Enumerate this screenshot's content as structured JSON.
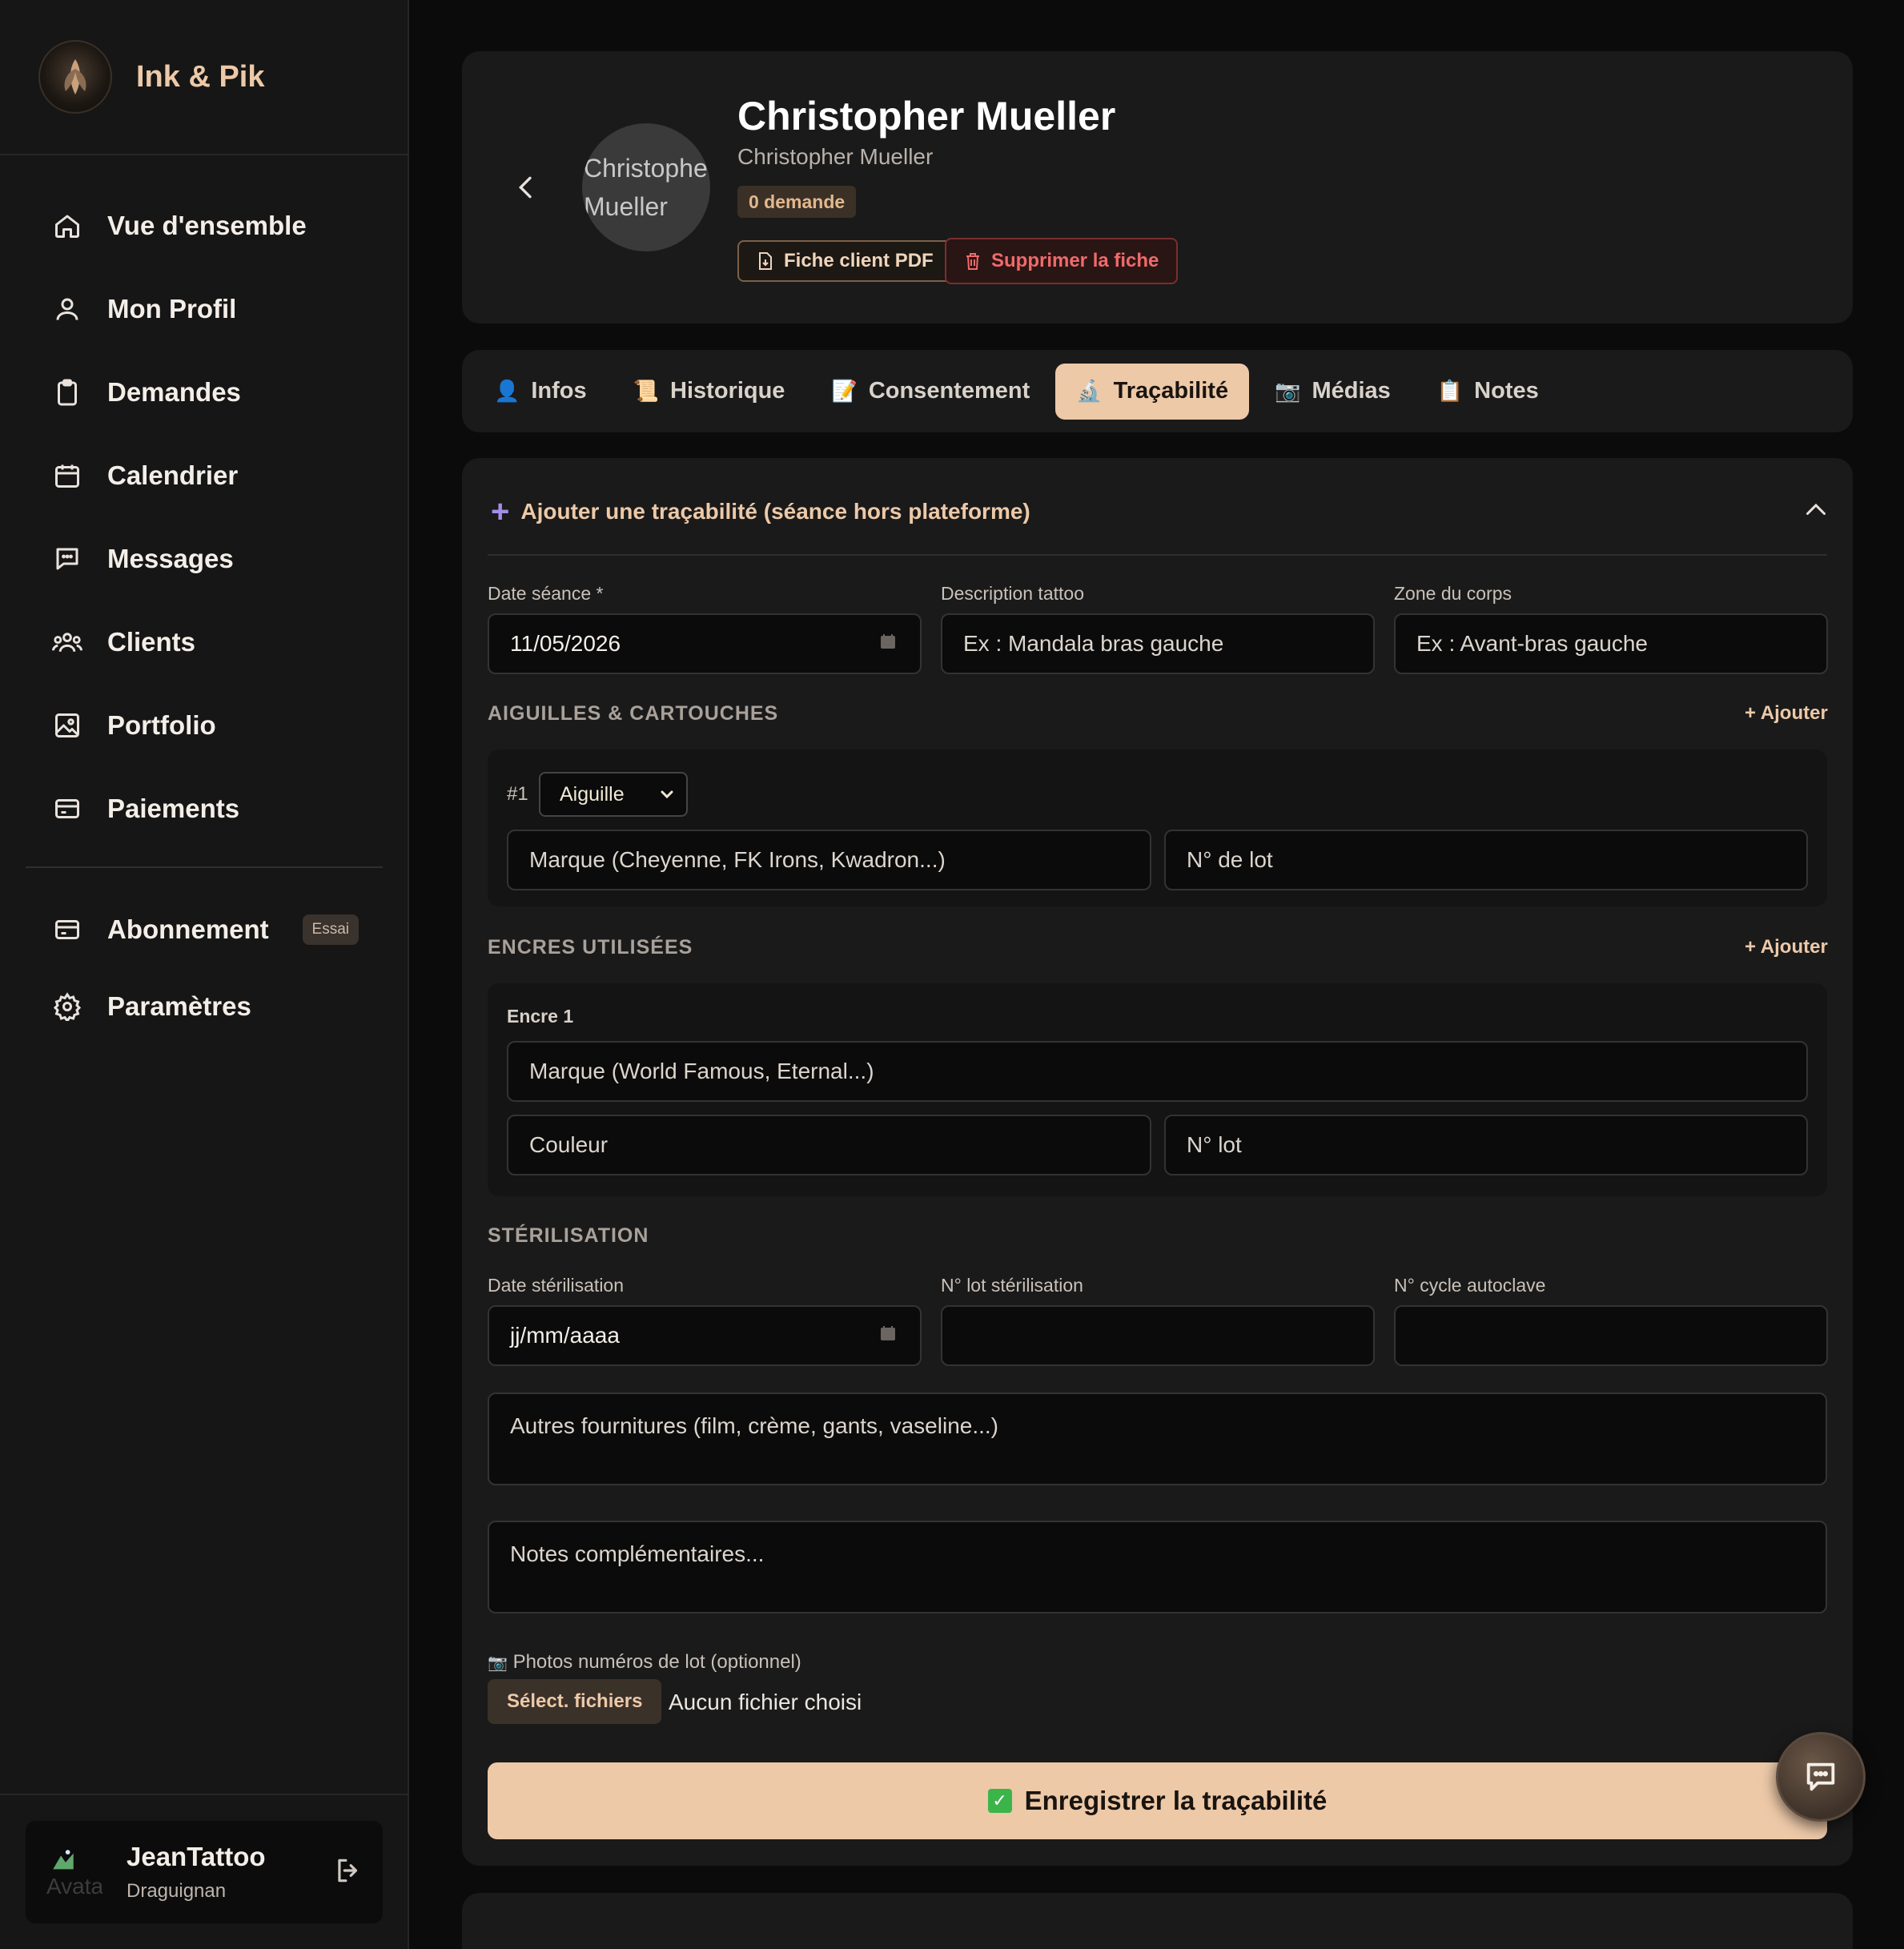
{
  "brand": {
    "name": "Ink & Pik"
  },
  "nav": [
    {
      "label": "Vue d'ensemble",
      "icon": "home-icon"
    },
    {
      "label": "Mon Profil",
      "icon": "user-icon"
    },
    {
      "label": "Demandes",
      "icon": "clipboard-icon"
    },
    {
      "label": "Calendrier",
      "icon": "calendar-icon"
    },
    {
      "label": "Messages",
      "icon": "message-icon"
    },
    {
      "label": "Clients",
      "icon": "users-icon"
    },
    {
      "label": "Portfolio",
      "icon": "image-icon"
    },
    {
      "label": "Paiements",
      "icon": "card-icon"
    }
  ],
  "nav2": {
    "subscription": {
      "label": "Abonnement",
      "badge": "Essai",
      "icon": "card-icon"
    },
    "settings": {
      "label": "Paramètres",
      "icon": "gear-icon"
    }
  },
  "user": {
    "name": "JeanTattoo",
    "city": "Draguignan",
    "avatar_alt": "Avatar"
  },
  "client": {
    "name": "Christopher Mueller",
    "subtitle": "Christopher Mueller",
    "avatar_alt": "Christopher Mueller",
    "badge": "0 demande",
    "pdf_button": "Fiche client PDF",
    "delete_button": "Supprimer la fiche"
  },
  "tabs": [
    {
      "label": "Infos",
      "icon": "👤",
      "active": false
    },
    {
      "label": "Historique",
      "icon": "📜",
      "active": false
    },
    {
      "label": "Consentement",
      "icon": "📝",
      "active": false
    },
    {
      "label": "Traçabilité",
      "icon": "🔬",
      "active": true
    },
    {
      "label": "Médias",
      "icon": "📷",
      "active": false
    },
    {
      "label": "Notes",
      "icon": "📋",
      "active": false
    }
  ],
  "form": {
    "title": "Ajouter une traçabilité (séance hors plateforme)",
    "date_label": "Date séance *",
    "date_value": "11/05/2026",
    "desc_label": "Description tattoo",
    "desc_placeholder": "Ex : Mandala bras gauche",
    "zone_label": "Zone du corps",
    "zone_placeholder": "Ex : Avant-bras gauche",
    "needles": {
      "title": "AIGUILLES & CARTOUCHES",
      "add": "+ Ajouter",
      "items": [
        {
          "num": "#1",
          "type": "Aiguille",
          "brand_placeholder": "Marque (Cheyenne, FK Irons, Kwadron...)",
          "lot_placeholder": "N° de lot"
        }
      ]
    },
    "inks": {
      "title": "ENCRES UTILISÉES",
      "add": "+ Ajouter",
      "items": [
        {
          "label": "Encre 1",
          "brand_placeholder": "Marque (World Famous, Eternal...)",
          "color_placeholder": "Couleur",
          "lot_placeholder": "N° lot"
        }
      ]
    },
    "sterilization": {
      "title": "STÉRILISATION",
      "date_label": "Date stérilisation",
      "date_placeholder": "jj/mm/aaaa",
      "lot_label": "N° lot stérilisation",
      "cycle_label": "N° cycle autoclave"
    },
    "supplies_placeholder": "Autres fournitures (film, crème, gants, vaseline...)",
    "notes_placeholder": "Notes complémentaires...",
    "photos": {
      "icon": "📷",
      "label": "Photos numéros de lot (optionnel)",
      "button": "Sélect. fichiers",
      "none": "Aucun fichier choisi"
    },
    "save_button": "Enregistrer la traçabilité"
  },
  "colors": {
    "accent": "#edc9a8",
    "danger": "#f06a6a",
    "background": "#0b0b0b",
    "card": "#1a1a1a"
  }
}
